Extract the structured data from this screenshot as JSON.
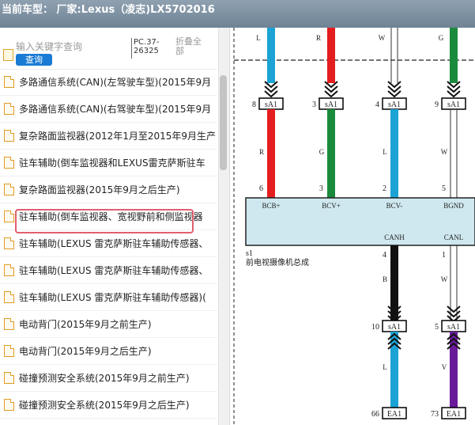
{
  "title": "当前车型： 厂家:Lexus（凌志)LX5702016",
  "search": {
    "placeholder": "输入关键字查询",
    "button": "查询",
    "pc_code": "PC.37-\n26325",
    "collapse_all": "折叠全部"
  },
  "tree_items": [
    {
      "label": "多路通信系统(CAN)(左驾驶车型)(2015年9月",
      "selected": false
    },
    {
      "label": "多路通信系统(CAN)(右驾驶车型)(2015年9月",
      "selected": false
    },
    {
      "label": "复杂路面监视器(2012年1月至2015年9月生产",
      "selected": false
    },
    {
      "label": "驻车辅助(倒车监视器和LEXUS雷克萨斯驻车",
      "selected": false
    },
    {
      "label": "复杂路面监视器(2015年9月之后生产)",
      "selected": true
    },
    {
      "label": "驻车辅助(倒车监视器、宽视野前和侧监视器",
      "selected": false
    },
    {
      "label": "驻车辅助(LEXUS 雷克萨斯驻车辅助传感器、",
      "selected": false
    },
    {
      "label": "驻车辅助(LEXUS 雷克萨斯驻车辅助传感器、",
      "selected": false
    },
    {
      "label": "驻车辅助(LEXUS 雷克萨斯驻车辅助传感器)(",
      "selected": false
    },
    {
      "label": "电动背门(2015年9月之前生产)",
      "selected": false
    },
    {
      "label": "电动背门(2015年9月之后生产)",
      "selected": false
    },
    {
      "label": "碰撞预测安全系统(2015年9月之前生产)",
      "selected": false
    },
    {
      "label": "碰撞预测安全系统(2015年9月之后生产)",
      "selected": false
    }
  ],
  "diagram": {
    "top_wire_colors": [
      "L",
      "R",
      "W",
      "G"
    ],
    "top_pins": [
      "8",
      "3",
      "4",
      "9"
    ],
    "top_connector": "sA1",
    "middle_wire_colors": [
      "R",
      "G",
      "L",
      "W"
    ],
    "module_pins_top": [
      "6",
      "3",
      "2",
      "5"
    ],
    "module_signals_top": [
      "BCB+",
      "BCV+",
      "BCV-",
      "BGND"
    ],
    "module_signals_bottom": [
      "CANH",
      "CANL"
    ],
    "module_pins_bottom": [
      "4",
      "1"
    ],
    "module_id": "s1",
    "module_name": "前电视摄像机总成",
    "lower_wire_colors": [
      "B",
      "W"
    ],
    "lower_pins": [
      "10",
      "5"
    ],
    "lower_connector": "sA1",
    "bottom_wire_colors": [
      "L",
      "V"
    ],
    "bottom_pins": [
      "66",
      "73"
    ],
    "bottom_connector": "EA1",
    "colors": {
      "L": "#1aa3d4",
      "R": "#e41e1e",
      "W": "#ffffff",
      "G": "#1a8a3c",
      "B": "#111111",
      "V": "#6a1b9a"
    }
  }
}
